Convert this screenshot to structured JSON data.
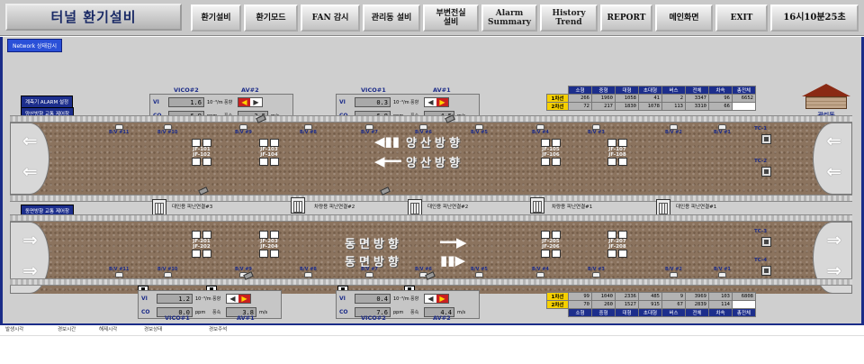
{
  "header": {
    "title": "터널 환기설비",
    "buttons": [
      {
        "id": "vent-equipment",
        "label": "환기설비"
      },
      {
        "id": "vent-mode",
        "label": "환기모드"
      },
      {
        "id": "fan-monitor",
        "label": "FAN 감시"
      },
      {
        "id": "mgmt-building",
        "label": "관리동 설비"
      },
      {
        "id": "substation",
        "label": "부변전실\n설비"
      },
      {
        "id": "alarm-summary",
        "label": "Alarm\nSummary"
      },
      {
        "id": "history-trend",
        "label": "History\nTrend"
      },
      {
        "id": "report",
        "label": "REPORT"
      },
      {
        "id": "main-screen",
        "label": "메인화면"
      },
      {
        "id": "exit",
        "label": "EXIT"
      }
    ],
    "clock": "16시10분25초"
  },
  "network_status": "Network 상태감시",
  "alarm_setting": "계측기 ALARM 설정",
  "upper_tunnel": {
    "traffic_title": "양산방향 교통 제어창",
    "direction_text": "양산방향",
    "fans": [
      "JF-101",
      "JF-102",
      "JF-103",
      "JF-104",
      "JF-105",
      "JF-106",
      "JF-107",
      "JF-108"
    ],
    "valves": [
      "B/V #11",
      "B/V #10",
      "B/V #9",
      "B/V #8",
      "B/V #7",
      "B/V #6",
      "B/V #5",
      "B/V #4",
      "B/V #3",
      "B/V #2",
      "B/V #1"
    ],
    "tc": [
      "TC-1",
      "TC-2"
    ]
  },
  "lower_tunnel": {
    "traffic_title": "동면방향 교통 제어창",
    "direction_text": "동면방향",
    "fans": [
      "JF-201",
      "JF-202",
      "JF-203",
      "JF-204",
      "JF-205",
      "JF-206",
      "JF-207",
      "JF-208"
    ],
    "valves": [
      "B/V #11",
      "B/V #10",
      "B/V #9",
      "B/V #8",
      "B/V #7",
      "B/V #6",
      "B/V #5",
      "B/V #4",
      "B/V #3",
      "B/V #2",
      "B/V #1"
    ],
    "tc": [
      "TC-3",
      "TC-4"
    ]
  },
  "sensors": [
    {
      "vico": "VICO#2",
      "av": "AV#2",
      "vi": "1.6",
      "co": "6.9",
      "ws": "3.5",
      "dir": "left"
    },
    {
      "vico": "VICO#1",
      "av": "AV#1",
      "vi": "0.3",
      "co": "6.8",
      "ws": "4.5",
      "dir": "right"
    },
    {
      "vico": "VICO#1",
      "av": "AV#1",
      "vi": "1.2",
      "co": "0.0",
      "ws": "3.8",
      "dir": "right"
    },
    {
      "vico": "VICO#2",
      "av": "AV#2",
      "vi": "0.4",
      "co": "7.6",
      "ws": "4.4",
      "dir": "right"
    }
  ],
  "sensor_labels": {
    "vi": "VI",
    "co": "CO",
    "vi_unit": "10⁻³/m",
    "co_unit": "ppm",
    "ws_unit": "m/s",
    "dir_label": "풍향",
    "speed_label": "풍속"
  },
  "shelters": {
    "evac_pass": [
      "대인용 피난연결#3",
      "차량용 피난연결#2",
      "대인용 피난연결#2",
      "차량용 피난연결#1",
      "대인용 피난연결#1"
    ]
  },
  "traffic_upper": {
    "headers": [
      "소형",
      "중형",
      "대형",
      "초대형",
      "버스",
      "전체",
      "차속",
      "총전체"
    ],
    "rows": [
      {
        "lane": "1차선",
        "values": [
          "266",
          "1960",
          "1058",
          "41",
          "2",
          "3347",
          "96",
          "6652"
        ]
      },
      {
        "lane": "2차선",
        "values": [
          "72",
          "217",
          "1830",
          "1078",
          "113",
          "3310",
          "66",
          ""
        ]
      }
    ]
  },
  "traffic_lower": {
    "headers": [
      "소형",
      "중형",
      "대형",
      "초대형",
      "버스",
      "전체",
      "차속",
      "총전체"
    ],
    "rows": [
      {
        "lane": "1차선",
        "values": [
          "99",
          "1040",
          "2336",
          "485",
          "9",
          "3969",
          "103",
          "6808"
        ]
      },
      {
        "lane": "2차선",
        "values": [
          "70",
          "260",
          "1527",
          "915",
          "67",
          "2839",
          "114",
          ""
        ]
      }
    ]
  },
  "mgmt_label": "관리동",
  "alarm_columns": [
    "발생시각",
    "경보시간",
    "해제시각",
    "경보상태",
    "경보주석"
  ]
}
